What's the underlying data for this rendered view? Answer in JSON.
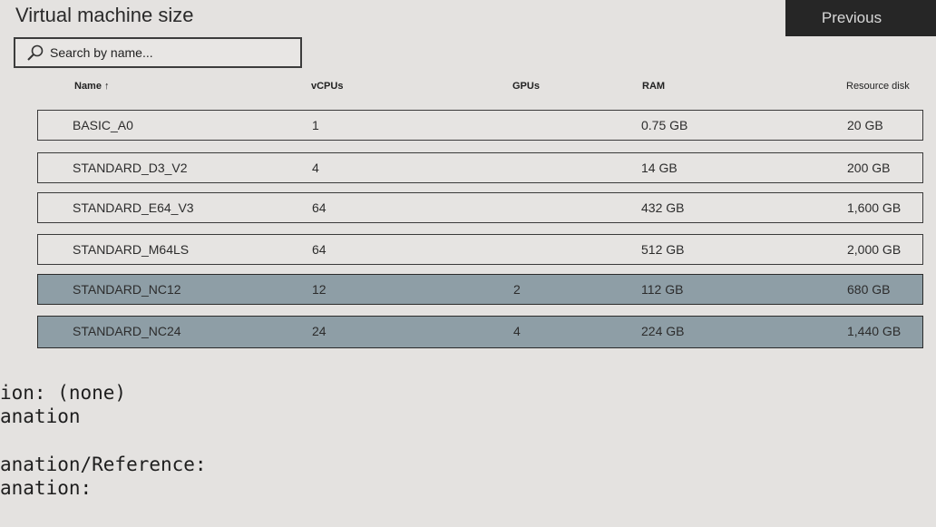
{
  "header": {
    "title": "Virtual machine size",
    "previous_label": "Previous"
  },
  "search": {
    "placeholder": "Search by name..."
  },
  "table": {
    "columns": [
      "Name ↑",
      "vCPUs",
      "GPUs",
      "RAM",
      "Resource disk"
    ],
    "rows": [
      {
        "name": "BASIC_A0",
        "vcpus": "1",
        "gpus": "",
        "ram": "0.75 GB",
        "disk": "20 GB",
        "selected": false
      },
      {
        "name": "STANDARD_D3_V2",
        "vcpus": "4",
        "gpus": "",
        "ram": "14 GB",
        "disk": "200 GB",
        "selected": false
      },
      {
        "name": "STANDARD_E64_V3",
        "vcpus": "64",
        "gpus": "",
        "ram": "432 GB",
        "disk": "1,600 GB",
        "selected": false
      },
      {
        "name": "STANDARD_M64LS",
        "vcpus": "64",
        "gpus": "",
        "ram": "512 GB",
        "disk": "2,000 GB",
        "selected": false
      },
      {
        "name": "STANDARD_NC12",
        "vcpus": "12",
        "gpus": "2",
        "ram": "112 GB",
        "disk": "680 GB",
        "selected": true
      },
      {
        "name": "STANDARD_NC24",
        "vcpus": "24",
        "gpus": "4",
        "ram": "224 GB",
        "disk": "1,440 GB",
        "selected": true
      }
    ]
  },
  "footer": {
    "line1": "ion: (none)",
    "line2": "anation",
    "line3": "anation/Reference:",
    "line4": "anation:"
  },
  "colors": {
    "selected_row": "#8e9ea6",
    "previous_button": "#262626"
  }
}
